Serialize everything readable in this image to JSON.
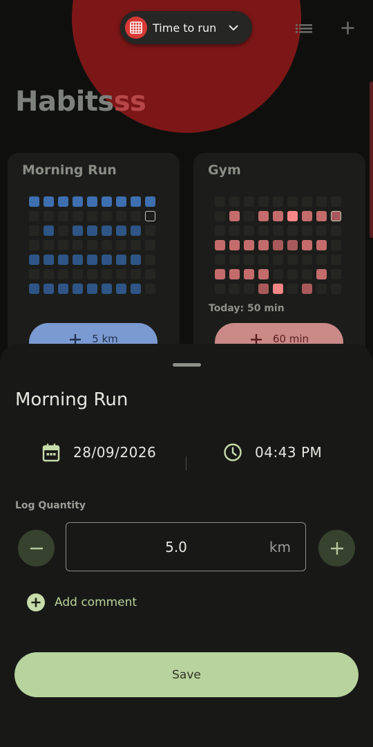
{
  "notification": {
    "title": "Time to run"
  },
  "header": {
    "title_main": "Habits",
    "title_accent": "ss"
  },
  "cards": [
    {
      "title": "Morning Run",
      "button_label": "5 km",
      "colors": {
        "accent": "#3e6fb0",
        "dim": "#2e5585",
        "button_bg": "#7b9ad2",
        "button_text": "#23324f"
      },
      "grid": [
        [
          2,
          2,
          2,
          2,
          2,
          2,
          2,
          2,
          2
        ],
        [
          0,
          0,
          0,
          0,
          0,
          0,
          0,
          0,
          9
        ],
        [
          0,
          1,
          0,
          1,
          1,
          1,
          1,
          1,
          0
        ],
        [
          0,
          0,
          0,
          0,
          0,
          0,
          0,
          0,
          0
        ],
        [
          1,
          1,
          1,
          1,
          1,
          1,
          1,
          1,
          0
        ],
        [
          0,
          0,
          0,
          0,
          0,
          0,
          0,
          0,
          0
        ],
        [
          1,
          1,
          1,
          1,
          1,
          1,
          1,
          1,
          0
        ]
      ]
    },
    {
      "title": "Gym",
      "today_label": "Today",
      "today_value": "50 min",
      "button_label": "60 min",
      "colors": {
        "accent": "#c46c6c",
        "dim": "#a85a5a",
        "button_bg": "#c98a88",
        "button_text": "#5a1d1d"
      },
      "grid": [
        [
          0,
          0,
          0,
          0,
          0,
          0,
          0,
          0,
          0
        ],
        [
          0,
          2,
          0,
          2,
          2,
          3,
          2,
          2,
          9
        ],
        [
          0,
          0,
          0,
          0,
          0,
          0,
          0,
          0,
          0
        ],
        [
          2,
          2,
          2,
          2,
          1,
          1,
          2,
          2,
          0
        ],
        [
          0,
          0,
          0,
          0,
          0,
          0,
          0,
          0,
          0
        ],
        [
          2,
          2,
          2,
          2,
          0,
          0,
          0,
          2,
          0
        ],
        [
          0,
          0,
          0,
          1,
          3,
          0,
          1,
          0,
          0
        ]
      ]
    }
  ],
  "sheet": {
    "title": "Morning Run",
    "date": "28/09/2026",
    "time": "04:43 PM",
    "quantity_label": "Log Quantity",
    "quantity_value": "5.0",
    "unit": "km",
    "add_comment_label": "Add comment",
    "save_label": "Save"
  },
  "icons": {
    "notification": "calendar-grid-icon",
    "header_left": "list-icon",
    "header_right": "plus-icon",
    "date": "calendar-icon",
    "time": "clock-icon",
    "decrement": "minus-icon",
    "increment": "plus-icon",
    "comment": "add-circle-icon"
  }
}
